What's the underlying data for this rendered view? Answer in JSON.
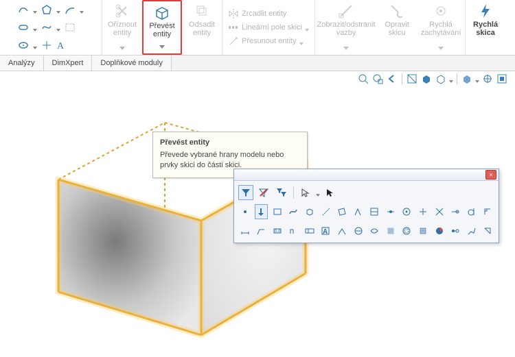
{
  "ribbon": {
    "trim": "Oříznout entity",
    "convert": "Převést entity",
    "offset": "Odsadit entity",
    "mirror": "Zrcadlit entity",
    "linear": "Lineární pole skici",
    "move": "Přesunout entity",
    "display": "Zobrazit/odstranit vazby",
    "repair": "Opravit skicu",
    "snap": "Rychlá zachytávání",
    "quick": "Rychlá skica"
  },
  "tabs": {
    "a": "Analýzy",
    "b": "DimXpert",
    "c": "Doplňkové moduly"
  },
  "tooltip": {
    "title": "Převést entity",
    "body": "Převede vybrané hrany modelu nebo prvky skici do části skici."
  },
  "palette": {
    "close": "×"
  }
}
